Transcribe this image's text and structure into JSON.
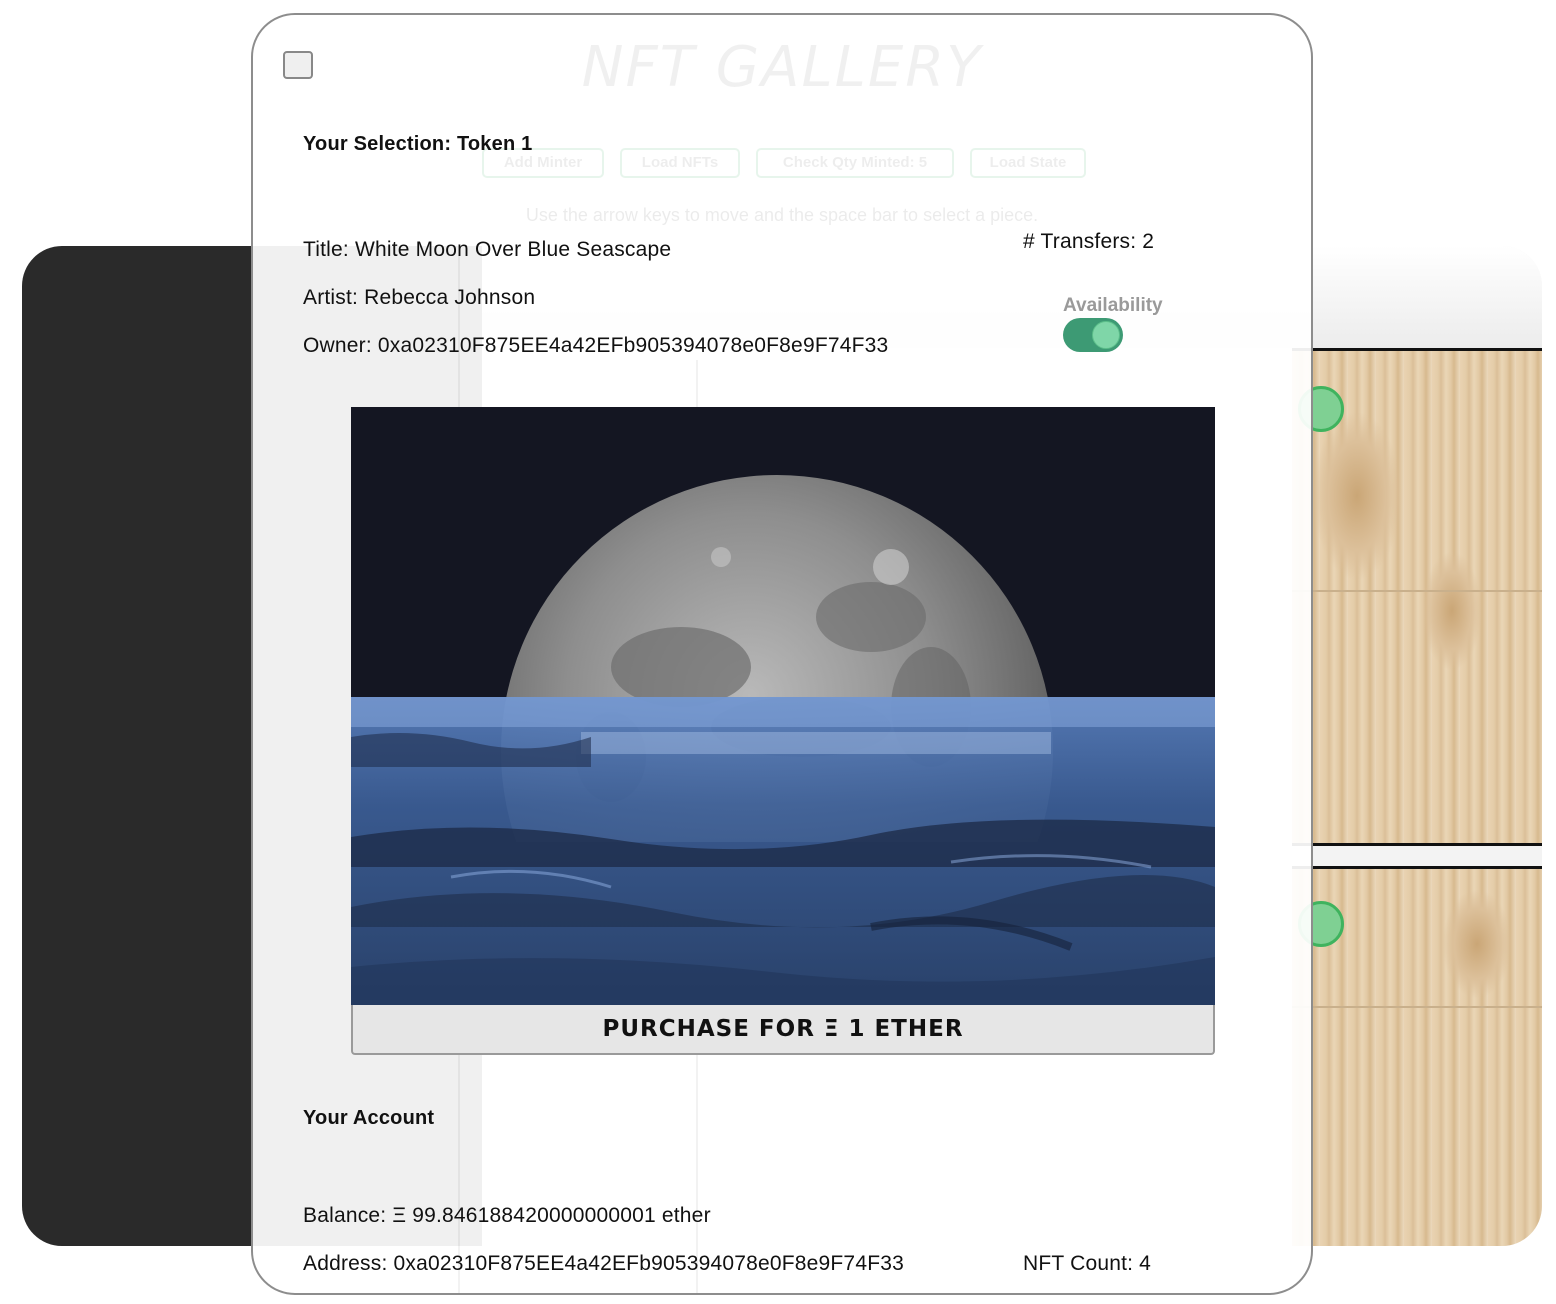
{
  "background_app": {
    "title": "NFT GALLERY",
    "buttons": [
      "Add Minter",
      "Load NFTs",
      "Check Qty Minted: 5",
      "Load State"
    ],
    "hint": "Use the arrow keys to move and the space bar to select a piece."
  },
  "modal": {
    "selection_heading": "Your Selection: Token 1",
    "title_line": "Title: White Moon Over Blue Seascape",
    "artist_line": "Artist: Rebecca Johnson",
    "owner_line": "Owner: 0xa02310F875EE4a42EFb905394078e0F8e9F74F33",
    "transfers_line": "# Transfers: 2",
    "availability_label": "Availability",
    "availability_on": true,
    "purchase_button": "PURCHASE FOR Ξ 1 ETHER",
    "account_heading": "Your Account",
    "balance_line": "Balance: Ξ 99.846188420000000001 ether",
    "address_line": "Address: 0xa02310F875EE4a42EFb905394078e0F8e9F74F33",
    "nft_count_line": "NFT Count: 4"
  },
  "colors": {
    "toggle_on": "#3d9a74",
    "accent_green": "#7fd093",
    "night_sky": "#141622",
    "sea_blue": "#3a5d96"
  }
}
